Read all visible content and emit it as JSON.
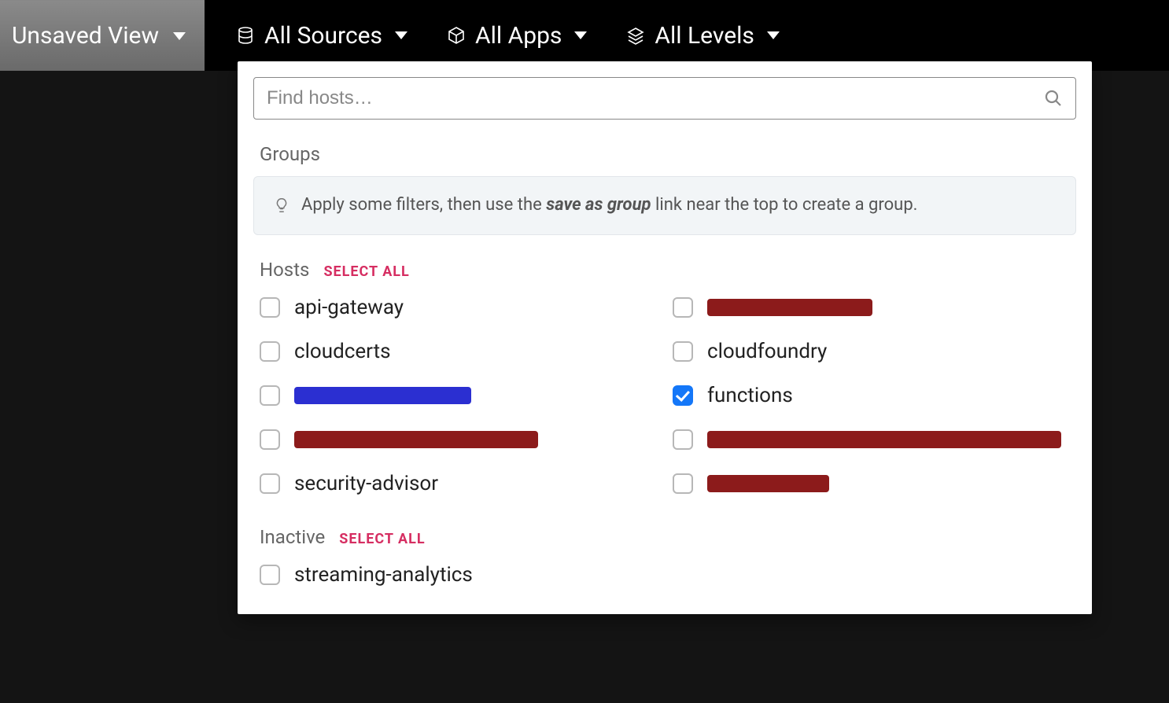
{
  "topbar": {
    "view_label": "Unsaved View",
    "filters": {
      "sources": "All Sources",
      "apps": "All Apps",
      "levels": "All Levels"
    }
  },
  "panel": {
    "search_placeholder": "Find hosts…",
    "groups_label": "Groups",
    "tip_prefix": "Apply some filters, then use the ",
    "tip_bold": "save as group",
    "tip_suffix": " link near the top to create a group.",
    "hosts_label": "Hosts",
    "select_all": "SELECT ALL",
    "inactive_label": "Inactive",
    "hosts": {
      "r0c0": "api-gateway",
      "r1c0": "cloudcerts",
      "r1c1": "cloudfoundry",
      "r2c1": "functions",
      "r4c0": "security-advisor"
    },
    "inactive_items": {
      "i0": "streaming-analytics"
    }
  }
}
